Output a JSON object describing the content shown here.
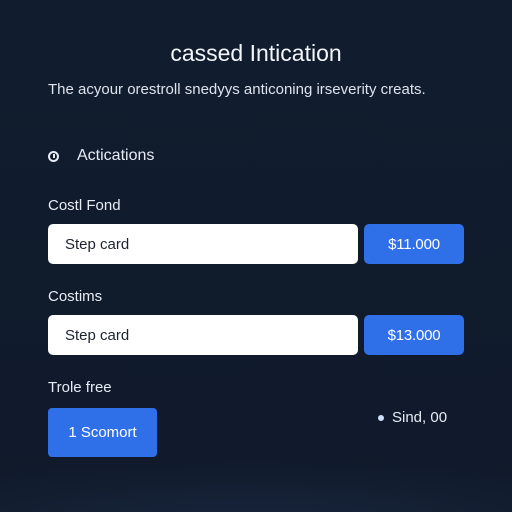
{
  "header": {
    "title": "cassed Intication",
    "subtitle": "The acyour orestroll snedyys anticoning irseverity creats."
  },
  "section": {
    "label": "Actications",
    "icon": "clock-icon"
  },
  "fields": [
    {
      "label": "Costl Fond",
      "input_value": "Step card",
      "price": "$11.000"
    },
    {
      "label": "Costims",
      "input_value": "Step card",
      "price": "$13.000"
    }
  ],
  "footer": {
    "label": "Trole free",
    "button_label": "1 Scomort",
    "status_text": "Sind, 00"
  },
  "colors": {
    "background": "#111c2e",
    "accent": "#2f6fe8",
    "input_bg": "#ffffff",
    "text": "#e7ecf6"
  }
}
